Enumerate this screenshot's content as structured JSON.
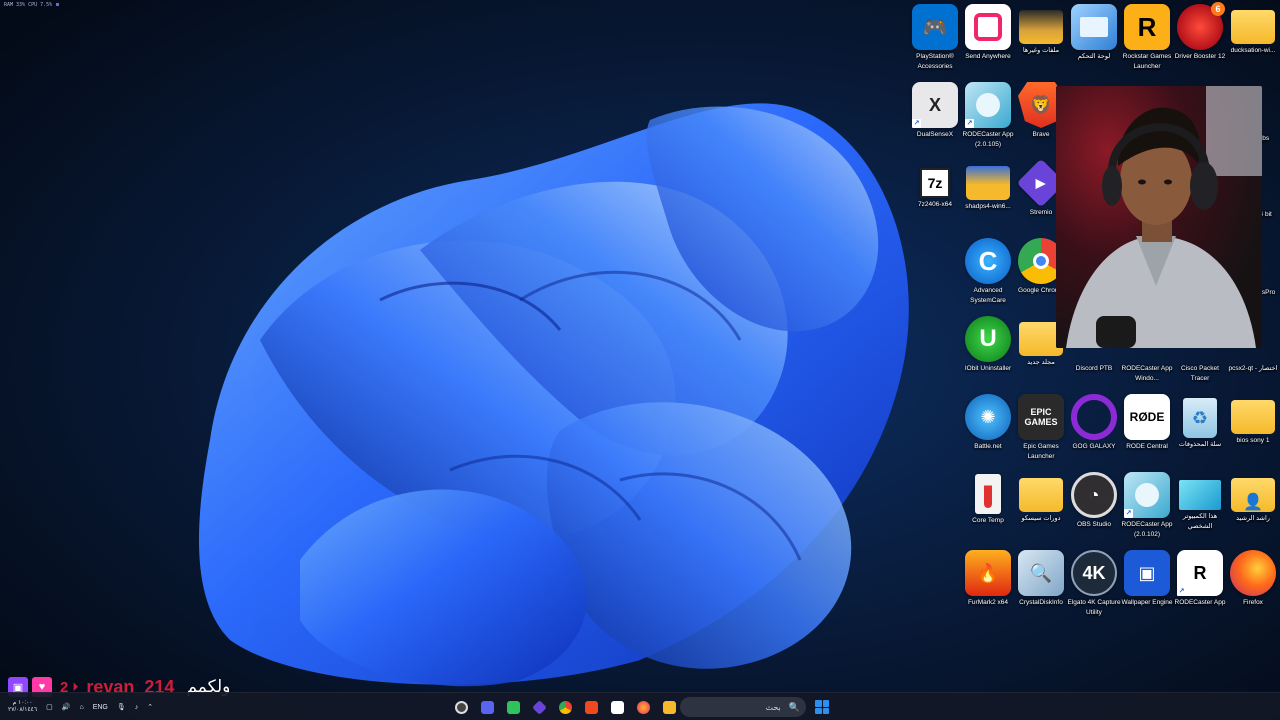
{
  "perf_overlay": {
    "text": "RAM 33%  CPU 7.5%"
  },
  "colors": {
    "wallpaper_bg": "#061224",
    "bloom_blue": "#1f5cff",
    "taskbar_bg": "#121826",
    "chat_name": "#d11b3a"
  },
  "desktop_icons": [
    {
      "label": "ducksation-wi...",
      "icon": "folder-icon"
    },
    {
      "label": "Driver Booster 12",
      "icon": "driver-booster-icon",
      "badge": "6"
    },
    {
      "label": "Rockstar Games Launcher",
      "icon": "rockstar-icon",
      "glyph": "R"
    },
    {
      "label": "لوحة التحكم",
      "icon": "control-panel-icon"
    },
    {
      "label": "ملفات وغيرها",
      "icon": "folder-icon"
    },
    {
      "label": "Send Anywhere",
      "icon": "send-anywhere-icon"
    },
    {
      "label": "PlayStation® Accessories",
      "icon": "playstation-accessories-icon"
    },
    {
      "label": "Brave",
      "icon": "brave-icon"
    },
    {
      "label": "RODECaster App (2.0.105)",
      "icon": "rodecaster-icon"
    },
    {
      "label": "DualSenseX",
      "icon": "dualsensex-icon"
    },
    {
      "label": "Stremio",
      "icon": "stremio-icon"
    },
    {
      "label": "shadps4-win6...",
      "icon": "folder-icon"
    },
    {
      "label": "7z2406-x64",
      "icon": "7zip-icon",
      "glyph": "7z"
    },
    {
      "label": "Google Chrome",
      "icon": "chrome-icon"
    },
    {
      "label": "Advanced SystemCare",
      "icon": "advanced-systemcare-icon",
      "glyph": "C"
    },
    {
      "label": "pcsx2-qt - اختصار",
      "icon": "pcsx2-icon"
    },
    {
      "label": "Cisco Packet Tracer",
      "icon": "cisco-icon"
    },
    {
      "label": "RODECaster App Windo...",
      "icon": "rodecaster-icon"
    },
    {
      "label": "Discord PTB",
      "icon": "discord-icon"
    },
    {
      "label": "مجلد جديد",
      "icon": "folder-icon"
    },
    {
      "label": "IObit Uninstaller",
      "icon": "iobit-icon",
      "glyph": "U"
    },
    {
      "label": "bios sony 1",
      "icon": "folder-icon"
    },
    {
      "label": "سلة المحذوفات",
      "icon": "recycle-bin-icon"
    },
    {
      "label": "RODE Central",
      "icon": "rode-central-icon",
      "glyph": "RØDE"
    },
    {
      "label": "GOG GALAXY",
      "icon": "gog-galaxy-icon"
    },
    {
      "label": "Epic Games Launcher",
      "icon": "epic-games-icon",
      "glyph": "EPIC GAMES"
    },
    {
      "label": "Battle.net",
      "icon": "battlenet-icon"
    },
    {
      "label": "راشد الرشيد",
      "icon": "user-folder-icon"
    },
    {
      "label": "هذا الكمبيوتر الشخصي",
      "icon": "this-pc-icon"
    },
    {
      "label": "RODECaster App (2.0.102)",
      "icon": "rodecaster-icon"
    },
    {
      "label": "OBS Studio",
      "icon": "obs-icon"
    },
    {
      "label": "دورات سيسكو",
      "icon": "folder-icon"
    },
    {
      "label": "Core Temp",
      "icon": "core-temp-icon"
    },
    {
      "label": "Firefox",
      "icon": "firefox-icon"
    },
    {
      "label": "RODECaster App",
      "icon": "rodecaster-app-icon"
    },
    {
      "label": "Wallpaper Engine",
      "icon": "wallpaper-engine-icon"
    },
    {
      "label": "Elgato 4K Capture Utility",
      "icon": "elgato-icon",
      "glyph": "4K"
    },
    {
      "label": "CrystalDiskInfo",
      "icon": "crystaldiskinfo-icon"
    },
    {
      "label": "FurMark2 x64",
      "icon": "furmark-icon"
    }
  ],
  "partial_labels": {
    "row2": "...bs",
    "row3": "...4 bit",
    "row4": "...ersPro"
  },
  "chat": {
    "count": "2",
    "username": "revan_214",
    "message": "ولكمم"
  },
  "taskbar": {
    "language": "ENG",
    "clock_time": "١٠:٠٠ م",
    "clock_date": "٢٧/٠٨/١٤٤٦",
    "search_placeholder": "بحث",
    "apps": [
      "obs-taskbar-icon",
      "discord-taskbar-icon",
      "play-taskbar-icon",
      "stremio-taskbar-icon",
      "chrome-taskbar-icon",
      "brave-taskbar-icon",
      "store-taskbar-icon",
      "firefox-taskbar-icon",
      "explorer-taskbar-icon"
    ]
  }
}
